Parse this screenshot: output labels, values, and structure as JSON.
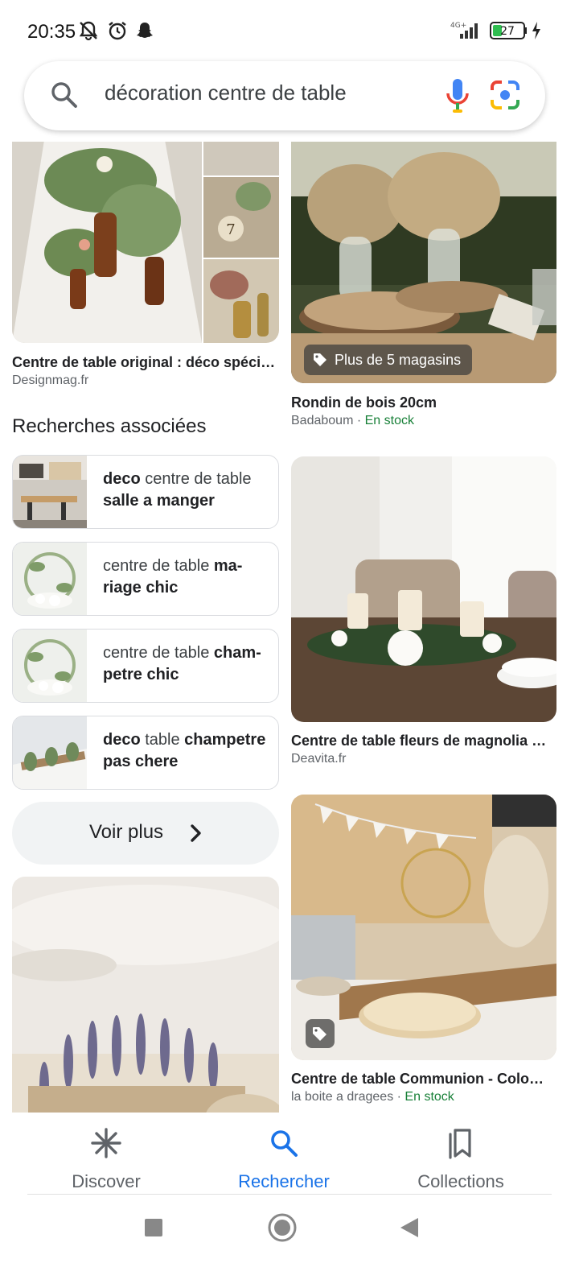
{
  "status_bar": {
    "time": "20:35",
    "network": "4G+",
    "battery": "27"
  },
  "search": {
    "query": "décoration centre de table"
  },
  "results": [
    {
      "title": "Centre de table original : déco spéci…",
      "source": "Designmag.fr"
    },
    {
      "title": "Rondin de bois 20cm",
      "source": "Badaboum",
      "stock": "En stock",
      "badge": "Plus de 5 magasins"
    },
    {
      "title": "Centre de table fleurs de magnolia …",
      "source": "Deavita.fr"
    },
    {
      "title": "Centre de table Communion - Colo…",
      "source": "la boite a dragees",
      "stock": "En stock"
    }
  ],
  "related": {
    "heading": "Recherches associées",
    "items": [
      {
        "parts": [
          {
            "t": "deco",
            "b": true
          },
          {
            "t": " centre de table ",
            "b": false
          },
          {
            "t": "salle a manger",
            "b": true
          }
        ]
      },
      {
        "parts": [
          {
            "t": "centre de table ",
            "b": false
          },
          {
            "t": "ma-riage chic",
            "b": true
          }
        ]
      },
      {
        "parts": [
          {
            "t": "centre de table ",
            "b": false
          },
          {
            "t": "cham-petre chic",
            "b": true
          }
        ]
      },
      {
        "parts": [
          {
            "t": "deco",
            "b": true
          },
          {
            "t": " table ",
            "b": false
          },
          {
            "t": "champetre pas chere",
            "b": true
          }
        ]
      }
    ],
    "more_label": "Voir plus"
  },
  "bottom_nav": [
    {
      "label": "Discover",
      "icon": "asterisk-icon",
      "active": false
    },
    {
      "label": "Rechercher",
      "icon": "search-icon",
      "active": true
    },
    {
      "label": "Collections",
      "icon": "bookmarks-icon",
      "active": false
    }
  ],
  "colors": {
    "accent": "#1a73e8",
    "in_stock": "#188038"
  }
}
